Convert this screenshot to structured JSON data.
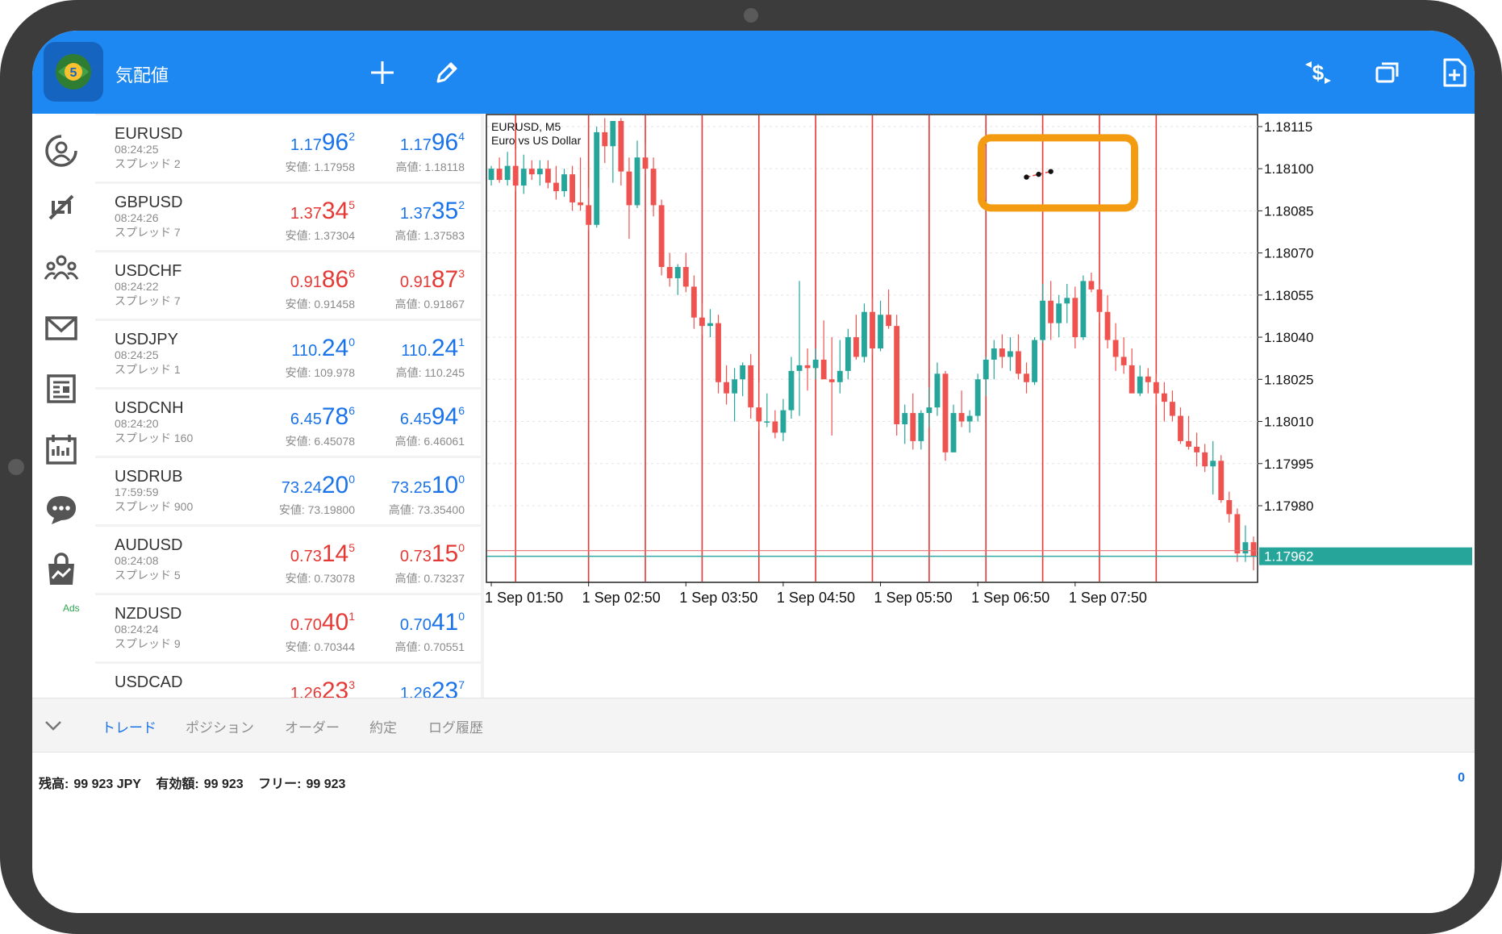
{
  "app": {
    "title": "気配値"
  },
  "quotes": [
    {
      "symbol": "EURUSD",
      "time": "08:24:25",
      "spread": "スプレッド 2",
      "bid": {
        "pre": "1.17",
        "big": "96",
        "sup": "2"
      },
      "ask": {
        "pre": "1.17",
        "big": "96",
        "sup": "4"
      },
      "low": "安値: 1.17958",
      "high": "高値: 1.18118",
      "color": "blue"
    },
    {
      "symbol": "GBPUSD",
      "time": "08:24:26",
      "spread": "スプレッド 7",
      "bid": {
        "pre": "1.37",
        "big": "34",
        "sup": "5"
      },
      "ask": {
        "pre": "1.37",
        "big": "35",
        "sup": "2"
      },
      "low": "安値: 1.37304",
      "high": "高値: 1.37583",
      "color": "mixed"
    },
    {
      "symbol": "USDCHF",
      "time": "08:24:22",
      "spread": "スプレッド 7",
      "bid": {
        "pre": "0.91",
        "big": "86",
        "sup": "6"
      },
      "ask": {
        "pre": "0.91",
        "big": "87",
        "sup": "3"
      },
      "low": "安値: 0.91458",
      "high": "高値: 0.91867",
      "color": "red"
    },
    {
      "symbol": "USDJPY",
      "time": "08:24:25",
      "spread": "スプレッド 1",
      "bid": {
        "pre": "110.",
        "big": "24",
        "sup": "0"
      },
      "ask": {
        "pre": "110.",
        "big": "24",
        "sup": "1"
      },
      "low": "安値: 109.978",
      "high": "高値: 110.245",
      "color": "blue"
    },
    {
      "symbol": "USDCNH",
      "time": "08:24:20",
      "spread": "スプレッド 160",
      "bid": {
        "pre": "6.45",
        "big": "78",
        "sup": "6"
      },
      "ask": {
        "pre": "6.45",
        "big": "94",
        "sup": "6"
      },
      "low": "安値: 6.45078",
      "high": "高値: 6.46061",
      "color": "blue"
    },
    {
      "symbol": "USDRUB",
      "time": "17:59:59",
      "spread": "スプレッド 900",
      "bid": {
        "pre": "73.24",
        "big": "20",
        "sup": "0"
      },
      "ask": {
        "pre": "73.25",
        "big": "10",
        "sup": "0"
      },
      "low": "安値: 73.19800",
      "high": "高値: 73.35400",
      "color": "blue"
    },
    {
      "symbol": "AUDUSD",
      "time": "08:24:08",
      "spread": "スプレッド 5",
      "bid": {
        "pre": "0.73",
        "big": "14",
        "sup": "5"
      },
      "ask": {
        "pre": "0.73",
        "big": "15",
        "sup": "0"
      },
      "low": "安値: 0.73078",
      "high": "高値: 0.73237",
      "color": "red"
    },
    {
      "symbol": "NZDUSD",
      "time": "08:24:24",
      "spread": "スプレッド 9",
      "bid": {
        "pre": "0.70",
        "big": "40",
        "sup": "1"
      },
      "ask": {
        "pre": "0.70",
        "big": "41",
        "sup": "0"
      },
      "low": "安値: 0.70344",
      "high": "高値: 0.70551",
      "color": "mixed2"
    },
    {
      "symbol": "USDCAD",
      "time": "",
      "spread": "",
      "bid": {
        "pre": "1.26",
        "big": "23",
        "sup": "3"
      },
      "ask": {
        "pre": "1.26",
        "big": "23",
        "sup": "7"
      },
      "low": "",
      "high": "",
      "color": "mixed"
    }
  ],
  "chart": {
    "symbol": "EURUSD, M5",
    "description": "Euro vs US Dollar",
    "current_price": "1.17962",
    "colors": {
      "bull": "#26a69a",
      "bear": "#ef5350",
      "vline": "#e53935",
      "highlight": "#f39c12",
      "bidline": "#26a69a",
      "askline": "#e57373"
    }
  },
  "chart_data": {
    "type": "candlestick",
    "title": "EURUSD, M5",
    "subtitle": "Euro vs US Dollar",
    "x_tick_labels": [
      "1 Sep 01:50",
      "1 Sep 02:50",
      "1 Sep 03:50",
      "1 Sep 04:50",
      "1 Sep 05:50",
      "1 Sep 06:50",
      "1 Sep 07:50"
    ],
    "y_tick_labels": [
      "1.18115",
      "1.18100",
      "1.18085",
      "1.18070",
      "1.18055",
      "1.18040",
      "1.18025",
      "1.18010",
      "1.17995",
      "1.17980"
    ],
    "ylim": [
      1.17953,
      1.18119
    ],
    "bid": 1.17962,
    "ask": 1.17964,
    "vlines_at_candle": [
      3,
      12,
      19,
      26,
      33,
      40,
      47,
      54,
      61,
      68,
      75,
      82
    ],
    "trendline": {
      "points": [
        [
          1.18097,
          66
        ],
        [
          1.18098,
          66
        ],
        [
          1.18099,
          69
        ]
      ]
    },
    "candles": [
      {
        "o": 1.18096,
        "h": 1.18101,
        "l": 1.18094,
        "c": 1.181
      },
      {
        "o": 1.181,
        "h": 1.18104,
        "l": 1.18095,
        "c": 1.18096
      },
      {
        "o": 1.18096,
        "h": 1.18106,
        "l": 1.18094,
        "c": 1.18101
      },
      {
        "o": 1.18101,
        "h": 1.18107,
        "l": 1.18092,
        "c": 1.18094
      },
      {
        "o": 1.18094,
        "h": 1.18105,
        "l": 1.18091,
        "c": 1.181
      },
      {
        "o": 1.181,
        "h": 1.18103,
        "l": 1.18096,
        "c": 1.18098
      },
      {
        "o": 1.18098,
        "h": 1.18103,
        "l": 1.18094,
        "c": 1.181
      },
      {
        "o": 1.181,
        "h": 1.18103,
        "l": 1.18093,
        "c": 1.18095
      },
      {
        "o": 1.18095,
        "h": 1.18101,
        "l": 1.18089,
        "c": 1.18092
      },
      {
        "o": 1.18092,
        "h": 1.181,
        "l": 1.1809,
        "c": 1.18098
      },
      {
        "o": 1.18098,
        "h": 1.18101,
        "l": 1.18085,
        "c": 1.18088
      },
      {
        "o": 1.18088,
        "h": 1.18104,
        "l": 1.18085,
        "c": 1.18087
      },
      {
        "o": 1.18087,
        "h": 1.18093,
        "l": 1.18078,
        "c": 1.1808
      },
      {
        "o": 1.1808,
        "h": 1.18115,
        "l": 1.18079,
        "c": 1.18113
      },
      {
        "o": 1.18113,
        "h": 1.18118,
        "l": 1.18102,
        "c": 1.18108
      },
      {
        "o": 1.18108,
        "h": 1.18114,
        "l": 1.18095,
        "c": 1.18117
      },
      {
        "o": 1.18117,
        "h": 1.18118,
        "l": 1.18094,
        "c": 1.18099
      },
      {
        "o": 1.18099,
        "h": 1.18104,
        "l": 1.18075,
        "c": 1.18087
      },
      {
        "o": 1.18087,
        "h": 1.1811,
        "l": 1.18086,
        "c": 1.18104
      },
      {
        "o": 1.18104,
        "h": 1.18109,
        "l": 1.18098,
        "c": 1.181
      },
      {
        "o": 1.181,
        "h": 1.18104,
        "l": 1.18083,
        "c": 1.18087
      },
      {
        "o": 1.18087,
        "h": 1.18089,
        "l": 1.18062,
        "c": 1.18065
      },
      {
        "o": 1.18065,
        "h": 1.1807,
        "l": 1.18058,
        "c": 1.18061
      },
      {
        "o": 1.18061,
        "h": 1.18066,
        "l": 1.18055,
        "c": 1.18065
      },
      {
        "o": 1.18065,
        "h": 1.1807,
        "l": 1.18056,
        "c": 1.18058
      },
      {
        "o": 1.18058,
        "h": 1.18062,
        "l": 1.18043,
        "c": 1.18047
      },
      {
        "o": 1.18047,
        "h": 1.18052,
        "l": 1.18041,
        "c": 1.18044
      },
      {
        "o": 1.18044,
        "h": 1.1805,
        "l": 1.1804,
        "c": 1.18045
      },
      {
        "o": 1.18045,
        "h": 1.18048,
        "l": 1.1802,
        "c": 1.18024
      },
      {
        "o": 1.18024,
        "h": 1.1803,
        "l": 1.18016,
        "c": 1.1802
      },
      {
        "o": 1.1802,
        "h": 1.18029,
        "l": 1.1801,
        "c": 1.18025
      },
      {
        "o": 1.18025,
        "h": 1.18031,
        "l": 1.18019,
        "c": 1.1803
      },
      {
        "o": 1.1803,
        "h": 1.18034,
        "l": 1.18011,
        "c": 1.18015
      },
      {
        "o": 1.18015,
        "h": 1.18024,
        "l": 1.18007,
        "c": 1.1801
      },
      {
        "o": 1.1801,
        "h": 1.1802,
        "l": 1.18008,
        "c": 1.1801
      },
      {
        "o": 1.1801,
        "h": 1.18014,
        "l": 1.18004,
        "c": 1.18006
      },
      {
        "o": 1.18006,
        "h": 1.18018,
        "l": 1.18003,
        "c": 1.18014
      },
      {
        "o": 1.18014,
        "h": 1.18033,
        "l": 1.18011,
        "c": 1.18028
      },
      {
        "o": 1.18028,
        "h": 1.1806,
        "l": 1.18012,
        "c": 1.1803
      },
      {
        "o": 1.1803,
        "h": 1.18036,
        "l": 1.18021,
        "c": 1.18029
      },
      {
        "o": 1.18029,
        "h": 1.18036,
        "l": 1.18025,
        "c": 1.18032
      },
      {
        "o": 1.18032,
        "h": 1.18046,
        "l": 1.18028,
        "c": 1.18025
      },
      {
        "o": 1.18025,
        "h": 1.1804,
        "l": 1.18005,
        "c": 1.18024
      },
      {
        "o": 1.18024,
        "h": 1.18039,
        "l": 1.1802,
        "c": 1.18028
      },
      {
        "o": 1.18028,
        "h": 1.18043,
        "l": 1.18025,
        "c": 1.1804
      },
      {
        "o": 1.1804,
        "h": 1.18048,
        "l": 1.18032,
        "c": 1.18033
      },
      {
        "o": 1.18033,
        "h": 1.18052,
        "l": 1.18031,
        "c": 1.18049
      },
      {
        "o": 1.18049,
        "h": 1.18054,
        "l": 1.18034,
        "c": 1.18036
      },
      {
        "o": 1.18036,
        "h": 1.18053,
        "l": 1.18035,
        "c": 1.18048
      },
      {
        "o": 1.18048,
        "h": 1.18057,
        "l": 1.18043,
        "c": 1.18044
      },
      {
        "o": 1.18044,
        "h": 1.18048,
        "l": 1.18005,
        "c": 1.18009
      },
      {
        "o": 1.18009,
        "h": 1.18016,
        "l": 1.18002,
        "c": 1.18013
      },
      {
        "o": 1.18013,
        "h": 1.1802,
        "l": 1.18,
        "c": 1.18003
      },
      {
        "o": 1.18003,
        "h": 1.18014,
        "l": 1.18,
        "c": 1.18013
      },
      {
        "o": 1.18013,
        "h": 1.18022,
        "l": 1.18008,
        "c": 1.18015
      },
      {
        "o": 1.18015,
        "h": 1.18031,
        "l": 1.18012,
        "c": 1.18027
      },
      {
        "o": 1.18027,
        "h": 1.18028,
        "l": 1.17996,
        "c": 1.17999
      },
      {
        "o": 1.17999,
        "h": 1.18016,
        "l": 1.17999,
        "c": 1.18013
      },
      {
        "o": 1.18013,
        "h": 1.18021,
        "l": 1.18008,
        "c": 1.1801
      },
      {
        "o": 1.1801,
        "h": 1.18014,
        "l": 1.18006,
        "c": 1.18012
      },
      {
        "o": 1.18012,
        "h": 1.18027,
        "l": 1.1801,
        "c": 1.18025
      },
      {
        "o": 1.18025,
        "h": 1.18033,
        "l": 1.18019,
        "c": 1.18032
      },
      {
        "o": 1.18032,
        "h": 1.18039,
        "l": 1.18025,
        "c": 1.18036
      },
      {
        "o": 1.18036,
        "h": 1.18041,
        "l": 1.18029,
        "c": 1.18033
      },
      {
        "o": 1.18033,
        "h": 1.1804,
        "l": 1.18028,
        "c": 1.18035
      },
      {
        "o": 1.18035,
        "h": 1.18041,
        "l": 1.18025,
        "c": 1.18027
      },
      {
        "o": 1.18027,
        "h": 1.18031,
        "l": 1.1802,
        "c": 1.18024
      },
      {
        "o": 1.18024,
        "h": 1.1804,
        "l": 1.18023,
        "c": 1.18039
      },
      {
        "o": 1.18039,
        "h": 1.18059,
        "l": 1.18038,
        "c": 1.18053
      },
      {
        "o": 1.18053,
        "h": 1.1806,
        "l": 1.18039,
        "c": 1.18045
      },
      {
        "o": 1.18045,
        "h": 1.18055,
        "l": 1.1804,
        "c": 1.18052
      },
      {
        "o": 1.18052,
        "h": 1.18059,
        "l": 1.18045,
        "c": 1.18054
      },
      {
        "o": 1.18054,
        "h": 1.18058,
        "l": 1.18036,
        "c": 1.1804
      },
      {
        "o": 1.1804,
        "h": 1.18062,
        "l": 1.18039,
        "c": 1.1806
      },
      {
        "o": 1.1806,
        "h": 1.18063,
        "l": 1.18056,
        "c": 1.18057
      },
      {
        "o": 1.18057,
        "h": 1.18059,
        "l": 1.18045,
        "c": 1.18049
      },
      {
        "o": 1.18049,
        "h": 1.18055,
        "l": 1.18036,
        "c": 1.18039
      },
      {
        "o": 1.18039,
        "h": 1.18045,
        "l": 1.18028,
        "c": 1.18033
      },
      {
        "o": 1.18033,
        "h": 1.1804,
        "l": 1.18027,
        "c": 1.1803
      },
      {
        "o": 1.1803,
        "h": 1.18036,
        "l": 1.18021,
        "c": 1.1802
      },
      {
        "o": 1.1802,
        "h": 1.1803,
        "l": 1.18019,
        "c": 1.18026
      },
      {
        "o": 1.18026,
        "h": 1.18029,
        "l": 1.1802,
        "c": 1.18024
      },
      {
        "o": 1.18024,
        "h": 1.18027,
        "l": 1.18016,
        "c": 1.1802
      },
      {
        "o": 1.1802,
        "h": 1.18024,
        "l": 1.1801,
        "c": 1.18017
      },
      {
        "o": 1.18017,
        "h": 1.18021,
        "l": 1.1801,
        "c": 1.18012
      },
      {
        "o": 1.18012,
        "h": 1.18015,
        "l": 1.18002,
        "c": 1.18003
      },
      {
        "o": 1.18003,
        "h": 1.18012,
        "l": 1.18,
        "c": 1.18001
      },
      {
        "o": 1.18001,
        "h": 1.18006,
        "l": 1.17994,
        "c": 1.17999
      },
      {
        "o": 1.17999,
        "h": 1.18002,
        "l": 1.17992,
        "c": 1.17994
      },
      {
        "o": 1.17994,
        "h": 1.18003,
        "l": 1.17984,
        "c": 1.17996
      },
      {
        "o": 1.17996,
        "h": 1.17998,
        "l": 1.17981,
        "c": 1.17982
      },
      {
        "o": 1.17982,
        "h": 1.17985,
        "l": 1.17974,
        "c": 1.17977
      },
      {
        "o": 1.17977,
        "h": 1.17979,
        "l": 1.1796,
        "c": 1.17963
      },
      {
        "o": 1.17963,
        "h": 1.17973,
        "l": 1.1796,
        "c": 1.17967
      },
      {
        "o": 1.17967,
        "h": 1.17969,
        "l": 1.17957,
        "c": 1.17962
      }
    ]
  },
  "tabs": [
    "トレード",
    "ポジション",
    "オーダー",
    "約定",
    "ログ履歴"
  ],
  "active_tab": 0,
  "account": {
    "balance_label": "残高:",
    "balance_value": "99 923 JPY",
    "equity_label": "有効額:",
    "equity_value": "99 923",
    "free_label": "フリー:",
    "free_value": "99 923",
    "count": "0"
  },
  "nav_ads": "Ads"
}
